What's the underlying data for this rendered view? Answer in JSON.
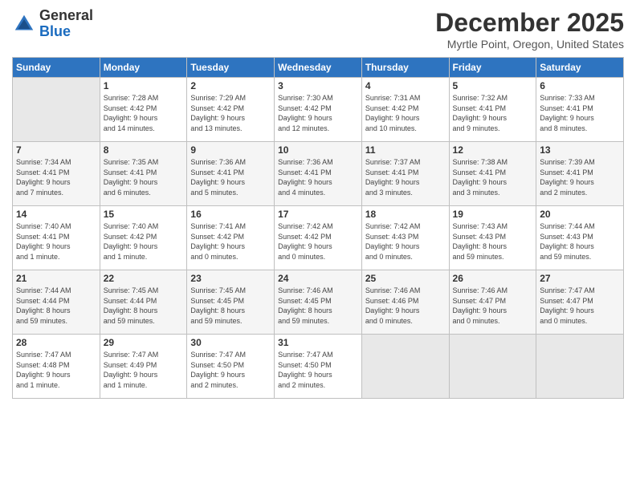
{
  "header": {
    "logo_general": "General",
    "logo_blue": "Blue",
    "month_title": "December 2025",
    "location": "Myrtle Point, Oregon, United States"
  },
  "days_of_week": [
    "Sunday",
    "Monday",
    "Tuesday",
    "Wednesday",
    "Thursday",
    "Friday",
    "Saturday"
  ],
  "weeks": [
    [
      {
        "day": "",
        "info": ""
      },
      {
        "day": "1",
        "info": "Sunrise: 7:28 AM\nSunset: 4:42 PM\nDaylight: 9 hours\nand 14 minutes."
      },
      {
        "day": "2",
        "info": "Sunrise: 7:29 AM\nSunset: 4:42 PM\nDaylight: 9 hours\nand 13 minutes."
      },
      {
        "day": "3",
        "info": "Sunrise: 7:30 AM\nSunset: 4:42 PM\nDaylight: 9 hours\nand 12 minutes."
      },
      {
        "day": "4",
        "info": "Sunrise: 7:31 AM\nSunset: 4:42 PM\nDaylight: 9 hours\nand 10 minutes."
      },
      {
        "day": "5",
        "info": "Sunrise: 7:32 AM\nSunset: 4:41 PM\nDaylight: 9 hours\nand 9 minutes."
      },
      {
        "day": "6",
        "info": "Sunrise: 7:33 AM\nSunset: 4:41 PM\nDaylight: 9 hours\nand 8 minutes."
      }
    ],
    [
      {
        "day": "7",
        "info": "Sunrise: 7:34 AM\nSunset: 4:41 PM\nDaylight: 9 hours\nand 7 minutes."
      },
      {
        "day": "8",
        "info": "Sunrise: 7:35 AM\nSunset: 4:41 PM\nDaylight: 9 hours\nand 6 minutes."
      },
      {
        "day": "9",
        "info": "Sunrise: 7:36 AM\nSunset: 4:41 PM\nDaylight: 9 hours\nand 5 minutes."
      },
      {
        "day": "10",
        "info": "Sunrise: 7:36 AM\nSunset: 4:41 PM\nDaylight: 9 hours\nand 4 minutes."
      },
      {
        "day": "11",
        "info": "Sunrise: 7:37 AM\nSunset: 4:41 PM\nDaylight: 9 hours\nand 3 minutes."
      },
      {
        "day": "12",
        "info": "Sunrise: 7:38 AM\nSunset: 4:41 PM\nDaylight: 9 hours\nand 3 minutes."
      },
      {
        "day": "13",
        "info": "Sunrise: 7:39 AM\nSunset: 4:41 PM\nDaylight: 9 hours\nand 2 minutes."
      }
    ],
    [
      {
        "day": "14",
        "info": "Sunrise: 7:40 AM\nSunset: 4:41 PM\nDaylight: 9 hours\nand 1 minute."
      },
      {
        "day": "15",
        "info": "Sunrise: 7:40 AM\nSunset: 4:42 PM\nDaylight: 9 hours\nand 1 minute."
      },
      {
        "day": "16",
        "info": "Sunrise: 7:41 AM\nSunset: 4:42 PM\nDaylight: 9 hours\nand 0 minutes."
      },
      {
        "day": "17",
        "info": "Sunrise: 7:42 AM\nSunset: 4:42 PM\nDaylight: 9 hours\nand 0 minutes."
      },
      {
        "day": "18",
        "info": "Sunrise: 7:42 AM\nSunset: 4:43 PM\nDaylight: 9 hours\nand 0 minutes."
      },
      {
        "day": "19",
        "info": "Sunrise: 7:43 AM\nSunset: 4:43 PM\nDaylight: 8 hours\nand 59 minutes."
      },
      {
        "day": "20",
        "info": "Sunrise: 7:44 AM\nSunset: 4:43 PM\nDaylight: 8 hours\nand 59 minutes."
      }
    ],
    [
      {
        "day": "21",
        "info": "Sunrise: 7:44 AM\nSunset: 4:44 PM\nDaylight: 8 hours\nand 59 minutes."
      },
      {
        "day": "22",
        "info": "Sunrise: 7:45 AM\nSunset: 4:44 PM\nDaylight: 8 hours\nand 59 minutes."
      },
      {
        "day": "23",
        "info": "Sunrise: 7:45 AM\nSunset: 4:45 PM\nDaylight: 8 hours\nand 59 minutes."
      },
      {
        "day": "24",
        "info": "Sunrise: 7:46 AM\nSunset: 4:45 PM\nDaylight: 8 hours\nand 59 minutes."
      },
      {
        "day": "25",
        "info": "Sunrise: 7:46 AM\nSunset: 4:46 PM\nDaylight: 9 hours\nand 0 minutes."
      },
      {
        "day": "26",
        "info": "Sunrise: 7:46 AM\nSunset: 4:47 PM\nDaylight: 9 hours\nand 0 minutes."
      },
      {
        "day": "27",
        "info": "Sunrise: 7:47 AM\nSunset: 4:47 PM\nDaylight: 9 hours\nand 0 minutes."
      }
    ],
    [
      {
        "day": "28",
        "info": "Sunrise: 7:47 AM\nSunset: 4:48 PM\nDaylight: 9 hours\nand 1 minute."
      },
      {
        "day": "29",
        "info": "Sunrise: 7:47 AM\nSunset: 4:49 PM\nDaylight: 9 hours\nand 1 minute."
      },
      {
        "day": "30",
        "info": "Sunrise: 7:47 AM\nSunset: 4:50 PM\nDaylight: 9 hours\nand 2 minutes."
      },
      {
        "day": "31",
        "info": "Sunrise: 7:47 AM\nSunset: 4:50 PM\nDaylight: 9 hours\nand 2 minutes."
      },
      {
        "day": "",
        "info": ""
      },
      {
        "day": "",
        "info": ""
      },
      {
        "day": "",
        "info": ""
      }
    ]
  ]
}
